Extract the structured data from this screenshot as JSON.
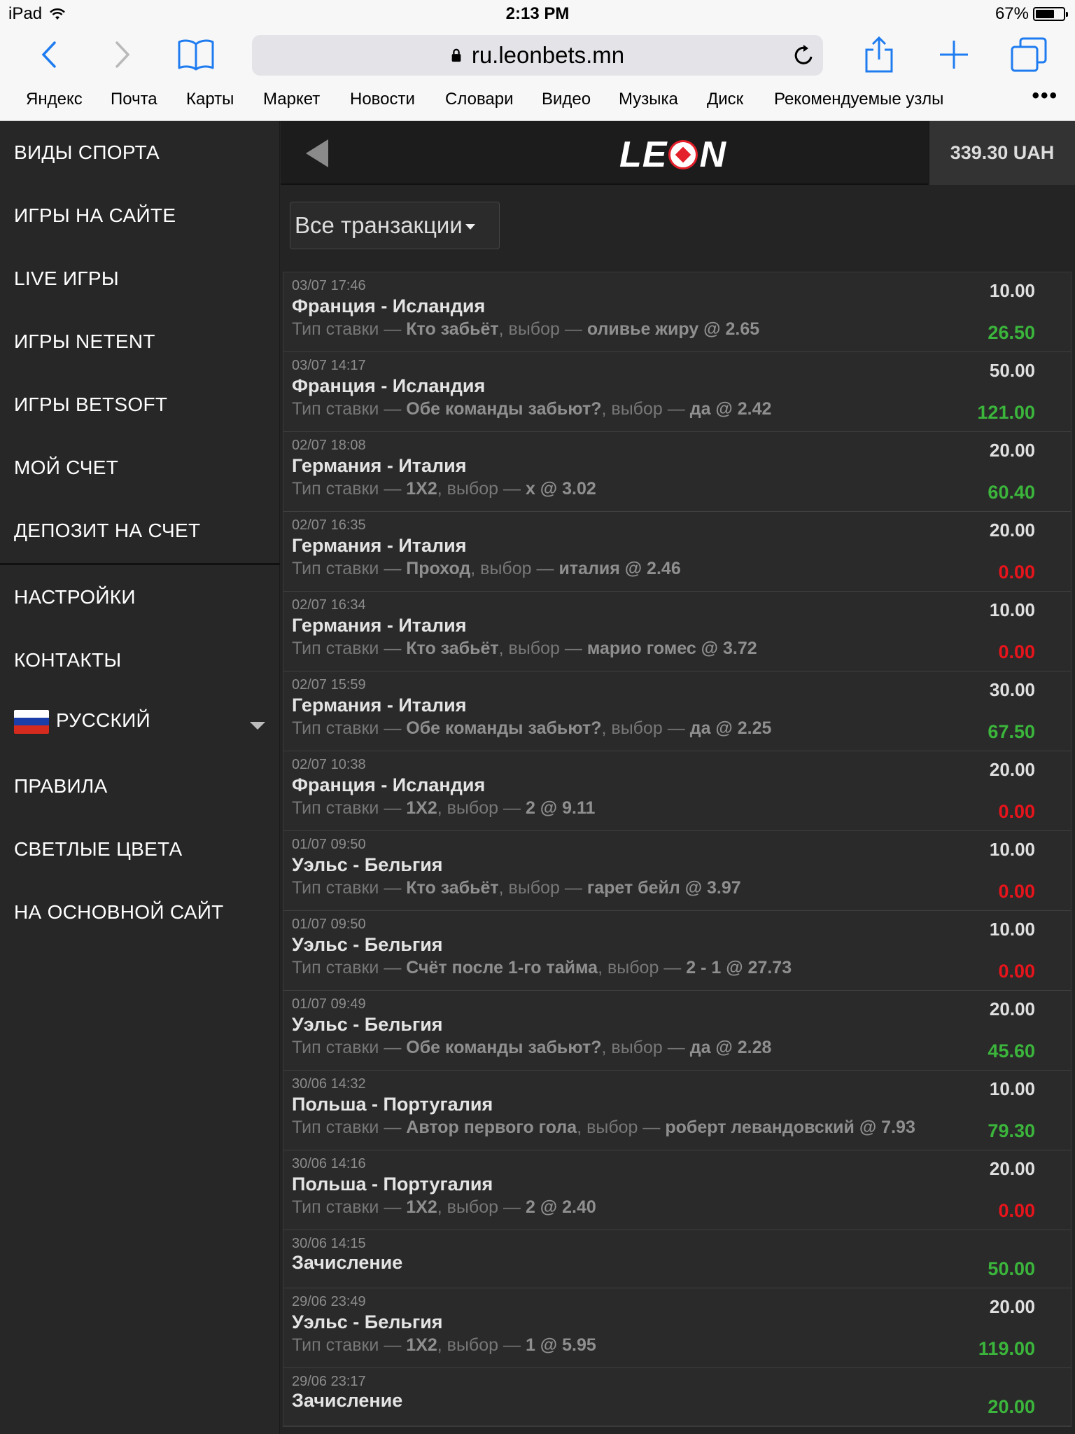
{
  "status_bar": {
    "device": "iPad",
    "time": "2:13 PM",
    "battery": "67%",
    "battery_level": 0.67
  },
  "browser": {
    "url": "ru.leonbets.mn",
    "bookmarks": [
      "Яндекс",
      "Почта",
      "Карты",
      "Маркет",
      "Новости",
      "Словари",
      "Видео",
      "Музыка",
      "Диск",
      "Рекомендуемые узлы"
    ],
    "more": "•••"
  },
  "sidebar": {
    "items": [
      "ВИДЫ СПОРТА",
      "ИГРЫ НА САЙТЕ",
      "LIVE ИГРЫ",
      "ИГРЫ NETENT",
      "ИГРЫ BETSOFT",
      "МОЙ СЧЕТ",
      "ДЕПОЗИТ НА СЧЕТ",
      "НАСТРОЙКИ",
      "КОНТАКТЫ",
      "РУССКИЙ",
      "ПРАВИЛА",
      "СВЕТЛЫЕ ЦВЕТА",
      "НА ОСНОВНОЙ САЙТ"
    ]
  },
  "header": {
    "logo_left": "LE",
    "logo_right": "N",
    "balance": "339.30 UAH"
  },
  "filter": {
    "selected": "Все транзакции"
  },
  "labels": {
    "bet_type": "Тип ставки — ",
    "choice": ", выбор — ",
    "odds_sep": " @ "
  },
  "transactions": [
    {
      "date": "03/07 17:46",
      "event": "Франция - Исландия",
      "bet_type": "Кто забьёт",
      "choice": "оливье жиру",
      "odds": "2.65",
      "stake": "10.00",
      "result": "26.50",
      "status": "win"
    },
    {
      "date": "03/07 14:17",
      "event": "Франция - Исландия",
      "bet_type": "Обе команды забьют?",
      "choice": "да",
      "odds": "2.42",
      "stake": "50.00",
      "result": "121.00",
      "status": "win"
    },
    {
      "date": "02/07 18:08",
      "event": "Германия - Италия",
      "bet_type": "1X2",
      "choice": "x",
      "odds": "3.02",
      "stake": "20.00",
      "result": "60.40",
      "status": "win"
    },
    {
      "date": "02/07 16:35",
      "event": "Германия - Италия",
      "bet_type": "Проход",
      "choice": "италия",
      "odds": "2.46",
      "stake": "20.00",
      "result": "0.00",
      "status": "lose"
    },
    {
      "date": "02/07 16:34",
      "event": "Германия - Италия",
      "bet_type": "Кто забьёт",
      "choice": "марио гомес",
      "odds": "3.72",
      "stake": "10.00",
      "result": "0.00",
      "status": "lose"
    },
    {
      "date": "02/07 15:59",
      "event": "Германия - Италия",
      "bet_type": "Обе команды забьют?",
      "choice": "да",
      "odds": "2.25",
      "stake": "30.00",
      "result": "67.50",
      "status": "win"
    },
    {
      "date": "02/07 10:38",
      "event": "Франция - Исландия",
      "bet_type": "1X2",
      "choice": "2",
      "odds": "9.11",
      "stake": "20.00",
      "result": "0.00",
      "status": "lose"
    },
    {
      "date": "01/07 09:50",
      "event": "Уэльс - Бельгия",
      "bet_type": "Кто забьёт",
      "choice": "гарет бейл",
      "odds": "3.97",
      "stake": "10.00",
      "result": "0.00",
      "status": "lose"
    },
    {
      "date": "01/07 09:50",
      "event": "Уэльс - Бельгия",
      "bet_type": "Счёт после 1-го тайма",
      "choice": "2 - 1",
      "odds": "27.73",
      "stake": "10.00",
      "result": "0.00",
      "status": "lose"
    },
    {
      "date": "01/07 09:49",
      "event": "Уэльс - Бельгия",
      "bet_type": "Обе команды забьют?",
      "choice": "да",
      "odds": "2.28",
      "stake": "20.00",
      "result": "45.60",
      "status": "win"
    },
    {
      "date": "30/06 14:32",
      "event": "Польша - Португалия",
      "bet_type": "Автор первого гола",
      "choice": "роберт левандовский",
      "odds": "7.93",
      "stake": "10.00",
      "result": "79.30",
      "status": "win"
    },
    {
      "date": "30/06 14:16",
      "event": "Польша - Португалия",
      "bet_type": "1X2",
      "choice": "2",
      "odds": "2.40",
      "stake": "20.00",
      "result": "0.00",
      "status": "lose"
    },
    {
      "date": "30/06 14:15",
      "event": "Зачисление",
      "result": "50.00",
      "status": "win"
    },
    {
      "date": "29/06 23:49",
      "event": "Уэльс - Бельгия",
      "bet_type": "1X2",
      "choice": "1",
      "odds": "5.95",
      "stake": "20.00",
      "result": "119.00",
      "status": "win"
    },
    {
      "date": "29/06 23:17",
      "event": "Зачисление",
      "result": "20.00",
      "status": "win"
    }
  ]
}
